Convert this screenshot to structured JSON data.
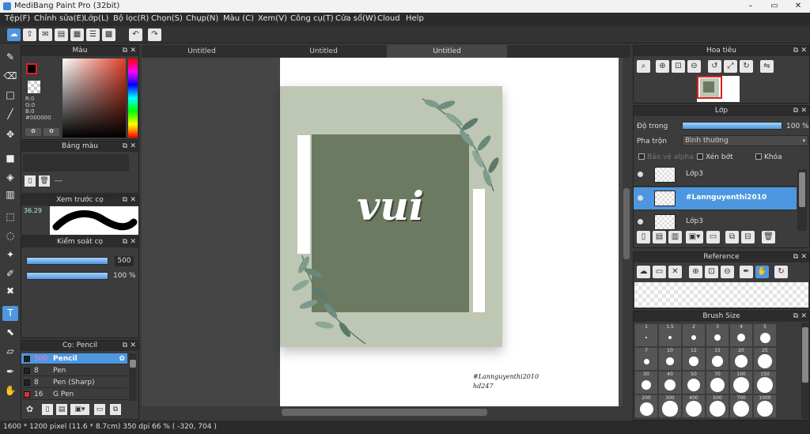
{
  "window": {
    "title": "MediBang Paint Pro (32bit)",
    "min": "–",
    "max": "▭",
    "close": "✕"
  },
  "menu": [
    "Tệp(F)",
    "Chỉnh sửa(E)",
    "Lớp(L)",
    "Bộ lọc(R)",
    "Chọn(S)",
    "Chụp(N)",
    "Màu (C)",
    "Xem(V)",
    "Công cụ(T)",
    "Cửa sổ(W)",
    "Cloud",
    "Help"
  ],
  "tabs": [
    "Untitled",
    "Untitled",
    "Untitled"
  ],
  "color_panel": {
    "title": "Màu",
    "r": "R:0",
    "g": "G:0",
    "b": "B:0",
    "hex": "#000000"
  },
  "palette_panel": {
    "title": "Bảng màu",
    "dash": "---"
  },
  "brush_preview": {
    "title": "Xem trước cọ",
    "size": "36.29"
  },
  "brush_control": {
    "title": "Kiểm soát cọ",
    "size_value": "500",
    "opacity_value": "100 %",
    "size_fill": 1.0,
    "opacity_fill": 1.0
  },
  "brush_list": {
    "title": "Cọ: Pencil",
    "items": [
      {
        "size": "500",
        "name": "Pencil",
        "color": "#222222",
        "selected": true
      },
      {
        "size": "8",
        "name": "Pen",
        "color": "#222222",
        "selected": false
      },
      {
        "size": "8",
        "name": "Pen (Sharp)",
        "color": "#222222",
        "selected": false
      },
      {
        "size": "16",
        "name": "G Pen",
        "color": "#e03030",
        "selected": false
      }
    ]
  },
  "artwork": {
    "word": "vui",
    "signature1": "#Lannguyenthi2010",
    "signature2": "hd247"
  },
  "navigator": {
    "title": "Hoa tiêu"
  },
  "layer_panel": {
    "title": "Lớp",
    "opacity_label": "Độ trong",
    "opacity_value": "100 %",
    "opacity_fill": 1.0,
    "blend_label": "Pha trộn",
    "blend_value": "Bình thường",
    "protect_alpha": "Bảo vệ alpha",
    "clipping": "Xén bớt",
    "lock": "Khóa",
    "layers": [
      {
        "name": "Lớp3",
        "selected": false
      },
      {
        "name": "#Lannguyenthi2010",
        "selected": true
      },
      {
        "name": "Lớp3",
        "selected": false
      }
    ]
  },
  "reference_panel": {
    "title": "Reference"
  },
  "brush_size_panel": {
    "title": "Brush Size",
    "sizes": [
      "1",
      "1.5",
      "2",
      "3",
      "4",
      "5",
      "7",
      "10",
      "12",
      "15",
      "20",
      "25",
      "30",
      "40",
      "50",
      "70",
      "100",
      "150",
      "200",
      "300",
      "400",
      "500",
      "700",
      "1000"
    ]
  },
  "status": {
    "text": "1600 * 1200 pixel   (11.6 * 8.7cm)   350 dpi   66 %   ( -320, 704 )"
  },
  "colors": {
    "accent": "#4d97e0",
    "canvas_bg": "#bec7b4",
    "square": "#6c7a62"
  }
}
